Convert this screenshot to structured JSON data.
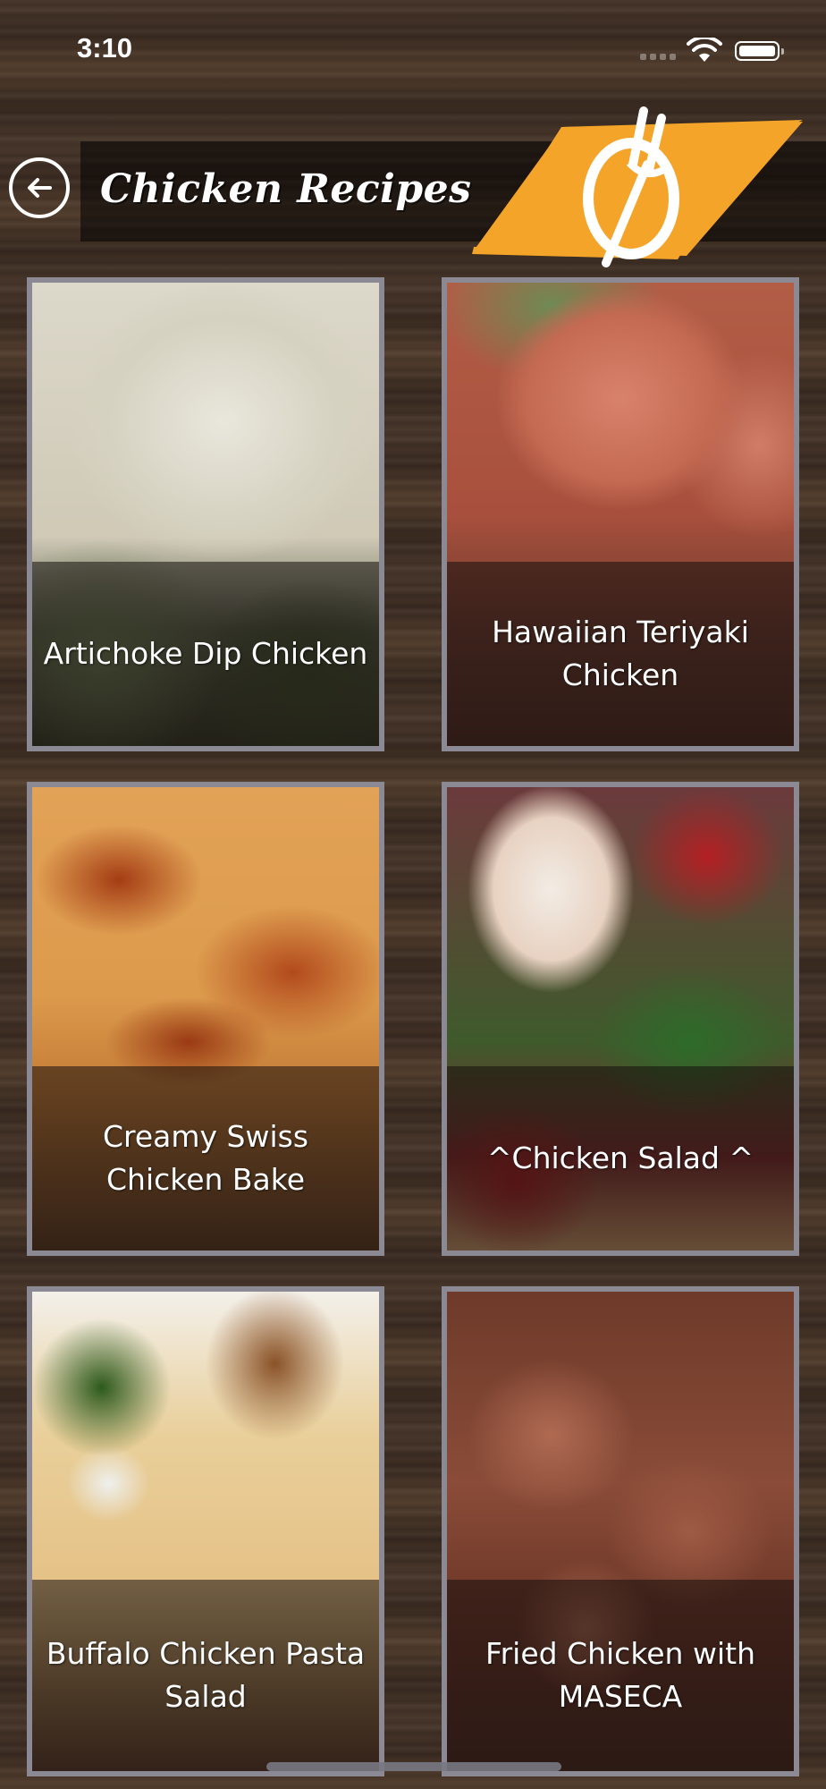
{
  "status_bar": {
    "time": "3:10"
  },
  "header": {
    "title": "Chicken Recipes",
    "back_icon": "arrow-left-circle-icon",
    "logo_icon": "fork-and-plate-icon",
    "logo_color": "#f5a42a"
  },
  "recipes": [
    {
      "title": "Artichoke Dip Chicken"
    },
    {
      "title": "Hawaiian Teriyaki Chicken"
    },
    {
      "title": "Creamy Swiss Chicken Bake"
    },
    {
      "title": "^Chicken Salad ^"
    },
    {
      "title": "Buffalo Chicken Pasta Salad"
    },
    {
      "title": "Fried Chicken with MASECA"
    }
  ]
}
